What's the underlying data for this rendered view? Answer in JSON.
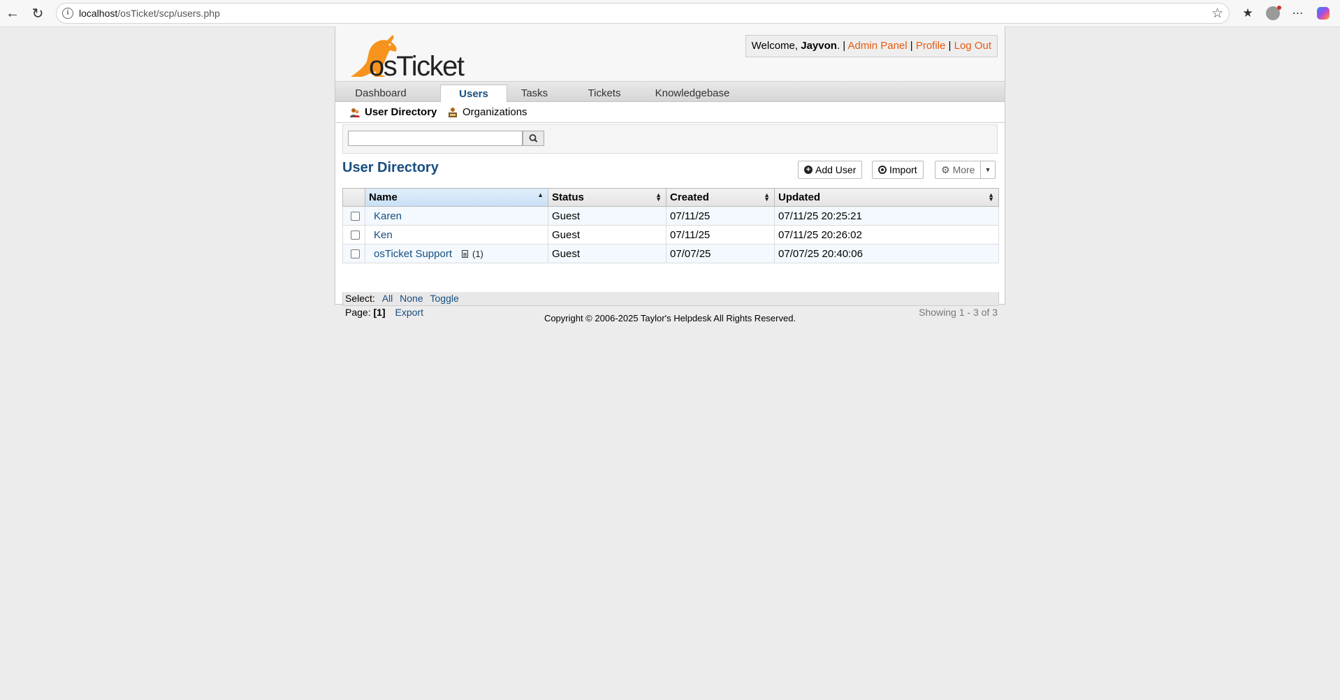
{
  "browser": {
    "url_host": "localhost",
    "url_path": "/osTicket/scp/users.php"
  },
  "header": {
    "logo_text": "osTicket",
    "welcome_prefix": "Welcome,",
    "user_name": "Jayvon",
    "welcome_suffix": ".",
    "sep": "|",
    "admin_panel": "Admin Panel",
    "profile": "Profile",
    "logout": "Log Out"
  },
  "nav": {
    "tabs": [
      "Dashboard",
      "Users",
      "Tasks",
      "Tickets",
      "Knowledgebase"
    ],
    "active": "Users"
  },
  "subnav": {
    "items": [
      "User Directory",
      "Organizations"
    ]
  },
  "search": {
    "placeholder": "",
    "value": ""
  },
  "page": {
    "title": "User Directory",
    "add_user": "Add User",
    "import": "Import",
    "more": "More"
  },
  "table": {
    "columns": [
      "Name",
      "Status",
      "Created",
      "Updated"
    ],
    "rows": [
      {
        "name": "Karen",
        "status": "Guest",
        "created": "07/11/25",
        "updated": "07/11/25 20:25:21",
        "notes": ""
      },
      {
        "name": "Ken",
        "status": "Guest",
        "created": "07/11/25",
        "updated": "07/11/25 20:26:02",
        "notes": ""
      },
      {
        "name": "osTicket Support",
        "status": "Guest",
        "created": "07/07/25",
        "updated": "07/07/25 20:40:06",
        "notes": "(1)"
      }
    ]
  },
  "select": {
    "label": "Select:",
    "all": "All",
    "none": "None",
    "toggle": "Toggle"
  },
  "pager": {
    "label": "Page:",
    "current": "[1]",
    "export": "Export",
    "showing": "Showing 1 - 3 of 3"
  },
  "footer": {
    "copyright": "Copyright © 2006-2025 Taylor's Helpdesk All Rights Reserved."
  },
  "colors": {
    "accent_link": "#e65b0e",
    "title_blue": "#184e81",
    "logo_orange": "#f7941d"
  }
}
